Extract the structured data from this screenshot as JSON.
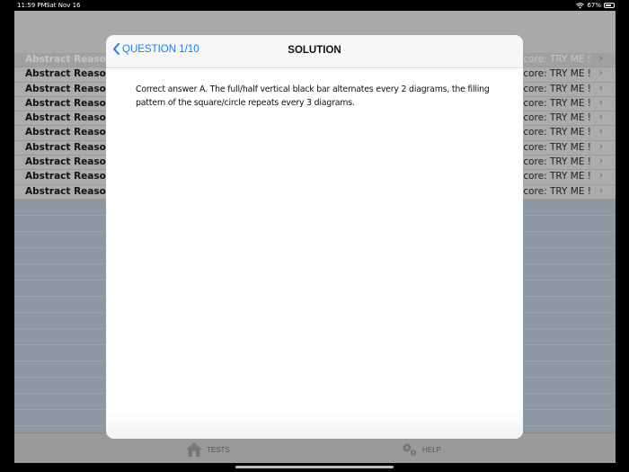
{
  "status_bar": {
    "time": "11:59 PM",
    "date": "Sat Nov 16",
    "battery": "67%"
  },
  "background_list": {
    "title": "",
    "rows": [
      {
        "left": "Abstract Reasoni",
        "right": "score: TRY ME !"
      },
      {
        "left": "Abstract Reasoni",
        "right": "score: TRY ME !"
      },
      {
        "left": "Abstract Reasoni",
        "right": "score: TRY ME !"
      },
      {
        "left": "Abstract Reasoni",
        "right": "score: TRY ME !"
      },
      {
        "left": "Abstract Reasoni",
        "right": "score: TRY ME !"
      },
      {
        "left": "Abstract Reasoni",
        "right": "score: TRY ME !"
      },
      {
        "left": "Abstract Reasoni",
        "right": "score: TRY ME !"
      },
      {
        "left": "Abstract Reasoni",
        "right": "score: TRY ME !"
      },
      {
        "left": "Abstract Reasoni",
        "right": "score: TRY ME !"
      },
      {
        "left": "Abstract Reasoni",
        "right": "score: TRY ME !"
      }
    ]
  },
  "tab_bar": {
    "tests_label": "TESTS",
    "help_label": "HELP"
  },
  "modal": {
    "back_label": "QUESTION 1/10",
    "title": "SOLUTION",
    "body": "Correct answer A. The full/half vertical black bar alternates every 2 diagrams, the filling pattern of the square/circle repeats every 3 diagrams."
  },
  "colors": {
    "accent": "#1b7cf4",
    "overlay": "#8e98a2"
  },
  "icons": [
    "wifi-icon",
    "battery-icon",
    "home-icon",
    "gear-icon",
    "chevron-left-icon",
    "chevron-right-icon"
  ]
}
